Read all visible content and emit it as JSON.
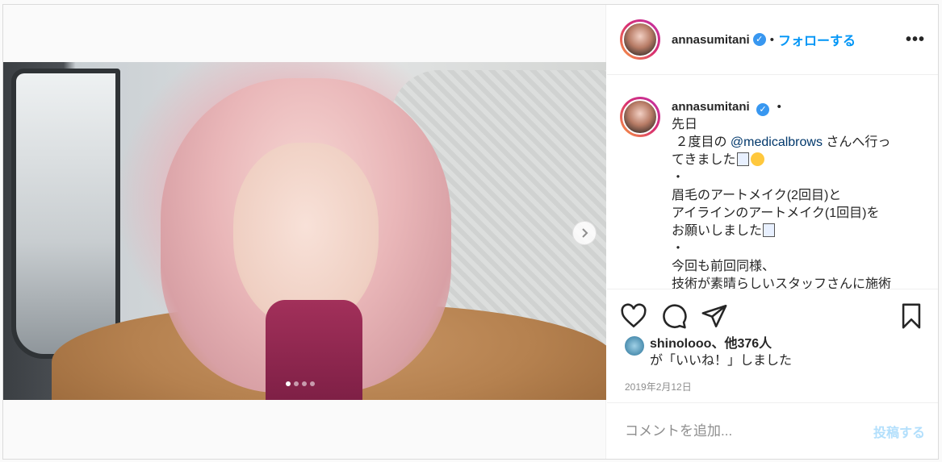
{
  "post": {
    "username": "annasumitani",
    "separator": "•",
    "follow_label": "フォローする",
    "more_label": "•••",
    "caption_lines": [
      "先日",
      " ２度目の ",
      "てきました",
      "・",
      "眉毛のアートメイク(2回目)と",
      "アイラインのアートメイク(1回目)を",
      "お願いしました",
      "・",
      "今回も前回同様、",
      "技術が素晴らしいスタッフさんに施術"
    ],
    "mention": "@medicalbrows",
    "mention_suffix": " さんへ行っ",
    "liker": "shinolooo",
    "likes_others": "、他376人",
    "likes_suffix": "が「いいね！」しました",
    "date": "2019年2月12日",
    "comment_placeholder": "コメントを追加...",
    "post_button": "投稿する",
    "carousel": {
      "count": 4,
      "active": 0
    }
  },
  "colors": {
    "accent": "#0095f6",
    "post_disabled": "#b2dffc",
    "verified": "#3897f0"
  },
  "icons": [
    "verified-badge-icon",
    "heart-icon",
    "comment-icon",
    "share-icon",
    "bookmark-icon",
    "chevron-right-icon"
  ]
}
